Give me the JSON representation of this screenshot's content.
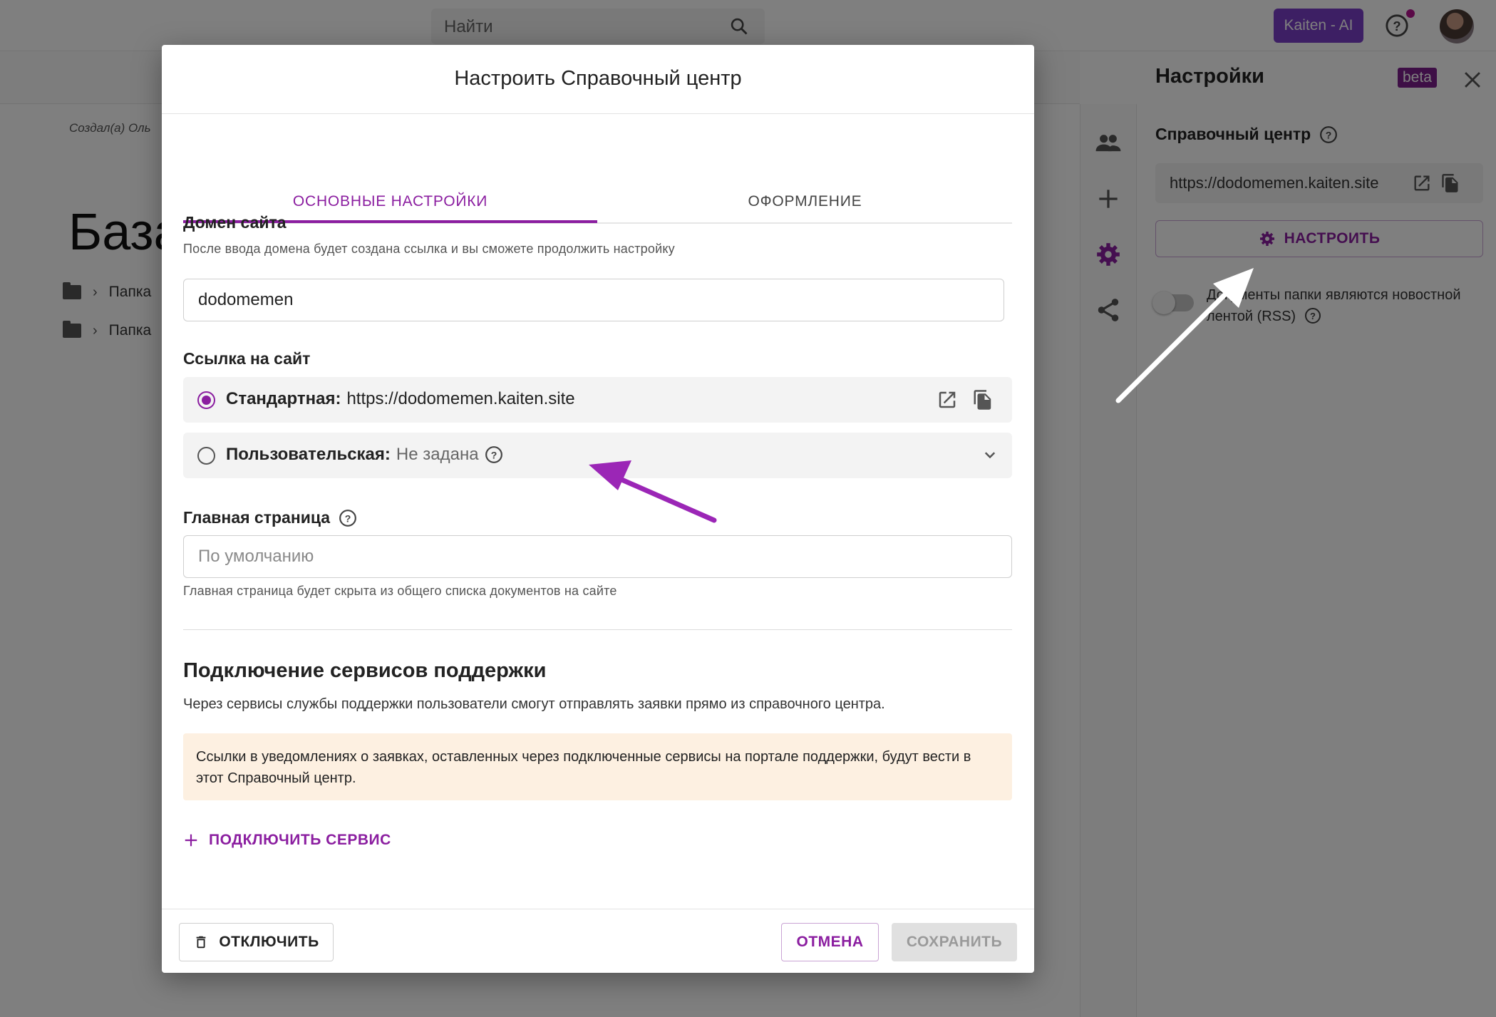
{
  "topbar": {
    "search_placeholder": "Найти",
    "ai_button": "Kaiten - AI"
  },
  "background": {
    "created_by": "Создал(а) Оль",
    "page_title": "База",
    "folders": [
      "Папка",
      "Папка"
    ]
  },
  "settings_panel": {
    "title": "Настройки",
    "beta": "beta",
    "section": "Справочный центр",
    "url": "https://dodomemen.kaiten.site",
    "configure_button": "НАСТРОИТЬ",
    "rss_label": "Документы папки являются новостной лентой (RSS)"
  },
  "modal": {
    "title": "Настроить Справочный центр",
    "tabs": [
      {
        "label": "ОСНОВНЫЕ НАСТРОЙКИ",
        "active": true
      },
      {
        "label": "ОФОРМЛЕНИЕ",
        "active": false
      }
    ],
    "domain": {
      "label": "Домен сайта",
      "hint": "После ввода домена будет создана ссылка и вы сможете продолжить настройку",
      "value": "dodomemen"
    },
    "site_link": {
      "label": "Ссылка на сайт",
      "standard_label": "Стандартная:",
      "standard_value": "https://dodomemen.kaiten.site",
      "custom_label": "Пользовательская:",
      "custom_value": "Не задана"
    },
    "home_page": {
      "label": "Главная страница",
      "placeholder": "По умолчанию",
      "hint": "Главная страница будет скрыта из общего списка документов на сайте"
    },
    "support": {
      "title": "Подключение сервисов поддержки",
      "description": "Через сервисы службы поддержки пользователи смогут отправлять заявки прямо из справочного центра.",
      "notice": "Ссылки в уведомлениях о заявках, оставленных через подключенные сервисы на портале поддержки, будут вести в этот Справочный центр.",
      "connect_button": "ПОДКЛЮЧИТЬ СЕРВИС"
    },
    "footer": {
      "disable_button": "ОТКЛЮЧИТЬ",
      "cancel_button": "ОТМЕНА",
      "save_button": "СОХРАНИТЬ"
    }
  },
  "colors": {
    "accent": "#8b1ea0",
    "ai_button": "#7b3fc8",
    "notice_bg": "#fdf0e1",
    "annotation_arrow_purple": "#9b26b6",
    "annotation_arrow_white": "#ffffff"
  },
  "icons": [
    "search-icon",
    "help-icon",
    "people-icon",
    "plus-icon",
    "gear-icon",
    "share-icon",
    "close-icon",
    "external-link-icon",
    "copy-icon",
    "chevron-down-icon",
    "trash-icon",
    "folder-icon"
  ]
}
